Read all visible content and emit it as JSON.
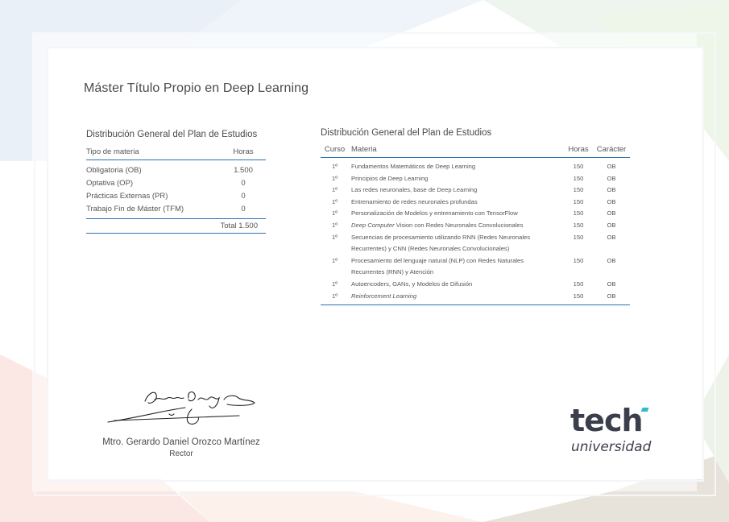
{
  "document": {
    "title": "Máster Título Propio en Deep Learning"
  },
  "summary_table": {
    "caption": "Distribución General del Plan de Estudios",
    "col_type": "Tipo de materia",
    "col_hours": "Horas",
    "rows": [
      {
        "type": "Obligatoria (OB)",
        "hours": "1.500"
      },
      {
        "type": "Optativa (OP)",
        "hours": "0"
      },
      {
        "type": "Prácticas Externas (PR)",
        "hours": "0"
      },
      {
        "type": "Trabajo Fin de Máster (TFM)",
        "hours": "0"
      }
    ],
    "total": "Total 1.500"
  },
  "detail_table": {
    "caption": "Distribución General del Plan de Estudios",
    "col_course": "Curso",
    "col_subject": "Materia",
    "col_hours": "Horas",
    "col_type": "Carácter",
    "rows": [
      {
        "course": "1º",
        "subject": "Fundamentos Matemáticos de Deep Learning",
        "hours": "150",
        "type": "OB"
      },
      {
        "course": "1º",
        "subject": "Principios de Deep Learning",
        "hours": "150",
        "type": "OB"
      },
      {
        "course": "1º",
        "subject": "Las redes neuronales, base de Deep Learning",
        "hours": "150",
        "type": "OB"
      },
      {
        "course": "1º",
        "subject": "Entrenamiento de redes neuronales profundas",
        "hours": "150",
        "type": "OB"
      },
      {
        "course": "1º",
        "subject": "Personalización de Modelos y entrenamiento con TensorFlow",
        "hours": "150",
        "type": "OB"
      },
      {
        "course": "1º",
        "subject_italic": "Deep Computer",
        "subject_rest": " Vision con Redes Neuronales Convolucionales",
        "hours": "150",
        "type": "OB"
      },
      {
        "course": "1º",
        "subject_line1": "Secuencias de procesamiento utilizando RNN (Redes Neuronales",
        "subject_line2": "Recurrentes) y CNN (Redes Neuronales Convolucionales)",
        "hours": "150",
        "type": "OB"
      },
      {
        "course": "1º",
        "subject_line1": "Procesamiento del lenguaje natural (NLP) con Redes Naturales",
        "subject_line2": "Recurrentes (RNN) y Atención",
        "hours": "150",
        "type": "OB"
      },
      {
        "course": "1º",
        "subject": "Autoencoders, GANs, y Modelos de Difusión",
        "hours": "150",
        "type": "OB"
      },
      {
        "course": "1º",
        "subject_italic": "Reinforcement Learning",
        "hours": "150",
        "type": "OB"
      }
    ]
  },
  "signatory": {
    "name": "Mtro. Gerardo Daniel Orozco Martínez",
    "role": "Rector"
  },
  "logo": {
    "wordmark": "tech",
    "subtitle": "universidad",
    "accent_color": "#35b8c9"
  },
  "colors": {
    "rule": "#2f6fb4",
    "text": "#4a4a4a"
  }
}
